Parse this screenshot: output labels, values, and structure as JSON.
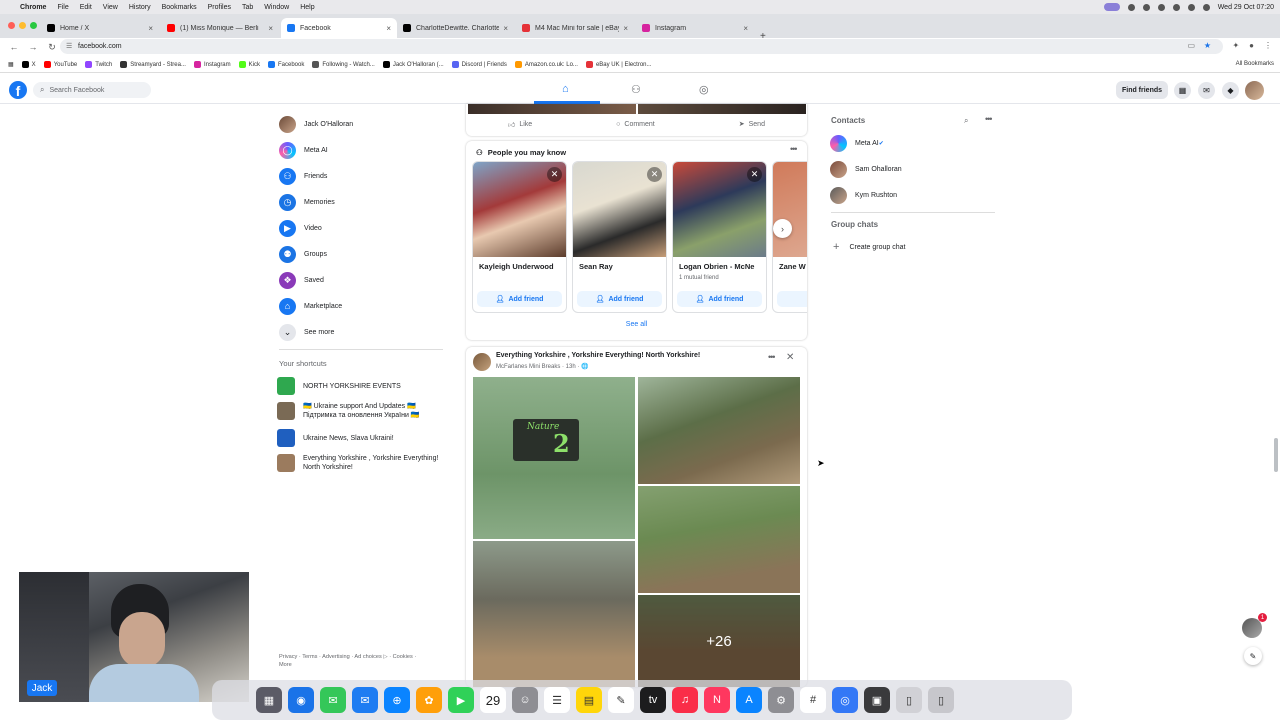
{
  "macos": {
    "menu": [
      "Chrome",
      "File",
      "Edit",
      "View",
      "History",
      "Bookmarks",
      "Profiles",
      "Tab",
      "Window",
      "Help"
    ],
    "clock": "Wed 29 Oct 07:20"
  },
  "browser": {
    "tabs": [
      {
        "title": "Home / X",
        "icon": "x-logo-icon",
        "color": "#000000"
      },
      {
        "title": "(1) Miss Monique — Berli",
        "icon": "youtube-icon",
        "color": "#ff0000"
      },
      {
        "title": "Facebook",
        "icon": "facebook-icon",
        "color": "#1877f2"
      },
      {
        "title": "CharlotteDewitte. Charlotte",
        "icon": "x-logo-icon",
        "color": "#000000"
      },
      {
        "title": "M4 Mac Mini for sale | eBay",
        "icon": "ebay-icon",
        "color": "#e53238"
      },
      {
        "title": "Instagram",
        "icon": "instagram-icon",
        "color": "#d6249f"
      }
    ],
    "url": "facebook.com",
    "bookmarks": [
      {
        "label": "X",
        "color": "#000000"
      },
      {
        "label": "YouTube",
        "color": "#ff0000"
      },
      {
        "label": "Twitch",
        "color": "#9146ff"
      },
      {
        "label": "Streamyard - Strea...",
        "color": "#333333"
      },
      {
        "label": "Instagram",
        "color": "#d6249f"
      },
      {
        "label": "Kick",
        "color": "#53fc18"
      },
      {
        "label": "Facebook",
        "color": "#1877f2"
      },
      {
        "label": "Following - Watch...",
        "color": "#555555"
      },
      {
        "label": "Jack O'Halloran (...",
        "color": "#000000"
      },
      {
        "label": "Discord | Friends",
        "color": "#5865f2"
      },
      {
        "label": "Amazon.co.uk: Lo...",
        "color": "#ff9900"
      },
      {
        "label": "eBay UK | Electron...",
        "color": "#e53238"
      }
    ],
    "all_bookmarks": "All Bookmarks"
  },
  "fb": {
    "search_placeholder": "Search Facebook",
    "find_friends": "Find friends",
    "leftnav": [
      {
        "label": "Jack O'Halloran",
        "icon": "profile-avatar",
        "color": "#8b6a55"
      },
      {
        "label": "Meta AI",
        "icon": "meta-ai-icon",
        "color": "#6a5cff"
      },
      {
        "label": "Friends",
        "icon": "friends-icon",
        "color": "#1877f2"
      },
      {
        "label": "Memories",
        "icon": "memories-icon",
        "color": "#1b74e4"
      },
      {
        "label": "Video",
        "icon": "video-icon",
        "color": "#1877f2"
      },
      {
        "label": "Groups",
        "icon": "groups-icon",
        "color": "#1b74e4"
      },
      {
        "label": "Saved",
        "icon": "saved-icon",
        "color": "#8a3ab9"
      },
      {
        "label": "Marketplace",
        "icon": "marketplace-icon",
        "color": "#1877f2"
      },
      {
        "label": "See more",
        "icon": "chevron-down-icon",
        "color": "#e4e6eb"
      }
    ],
    "shortcuts_title": "Your shortcuts",
    "shortcuts": [
      {
        "label": "NORTH YORKSHIRE EVENTS",
        "color": "#2fa84f"
      },
      {
        "label": "🇺🇦 Ukraine support And Updates 🇺🇦 Підтримка та оновлення України 🇺🇦",
        "color": "#7a6a55"
      },
      {
        "label": "Ukraine News, Slava Ukraini!",
        "color": "#1f5fbf"
      },
      {
        "label": "Everything Yorkshire , Yorkshire Everything! North Yorkshire!",
        "color": "#9b7b5e"
      }
    ],
    "footer": "Privacy · Terms · Advertising · Ad choices ▷ · Cookies · More",
    "actions": {
      "like": "Like",
      "comment": "Comment",
      "send": "Send"
    },
    "pymk": {
      "title": "People you may know",
      "people": [
        {
          "name": "Kayleigh Underwood",
          "mutual": "",
          "add": "Add friend"
        },
        {
          "name": "Sean Ray",
          "mutual": "",
          "add": "Add friend"
        },
        {
          "name": "Logan Obrien - McNe",
          "mutual": "1 mutual friend",
          "add": "Add friend"
        },
        {
          "name": "Zane W",
          "mutual": "",
          "add": ""
        }
      ],
      "see_all": "See all"
    },
    "post": {
      "group": "Everything Yorkshire , Yorkshire Everything! North Yorkshire!",
      "meta": "McFarlanes Mini Breaks · 13h · 🌐",
      "sign_text_1": "Nature",
      "sign_text_2": "2",
      "more_count": "+26"
    },
    "contacts_title": "Contacts",
    "contacts": [
      {
        "name": "Meta AI",
        "color": "#6a5cff"
      },
      {
        "name": "Sam Ohalloran",
        "color": "#7a4a3a"
      },
      {
        "name": "Kym Rushton",
        "color": "#5a5a5a"
      }
    ],
    "group_chats_title": "Group chats",
    "create_group": "Create group chat",
    "chat_badge": "1"
  },
  "webcam": {
    "name": "Jack"
  },
  "dock": [
    {
      "icon": "launchpad-icon",
      "color": "#5b5b66"
    },
    {
      "icon": "chrome-icon",
      "color": "#1a73e8"
    },
    {
      "icon": "messages-icon",
      "color": "#34c759"
    },
    {
      "icon": "mail-icon",
      "color": "#1e7cf2"
    },
    {
      "icon": "safari-icon",
      "color": "#0a84ff"
    },
    {
      "icon": "photos-icon",
      "color": "#ff9f0a"
    },
    {
      "icon": "facetime-icon",
      "color": "#30d158"
    },
    {
      "icon": "calendar-icon",
      "color": "#ffffff",
      "text": "29"
    },
    {
      "icon": "contacts-icon",
      "color": "#8e8e93"
    },
    {
      "icon": "reminders-icon",
      "color": "#ffffff"
    },
    {
      "icon": "notes-icon",
      "color": "#ffd60a"
    },
    {
      "icon": "freeform-icon",
      "color": "#ffffff"
    },
    {
      "icon": "tv-icon",
      "color": "#1c1c1e"
    },
    {
      "icon": "music-icon",
      "color": "#fa2d48"
    },
    {
      "icon": "news-icon",
      "color": "#ff375f"
    },
    {
      "icon": "app-store-icon",
      "color": "#0a84ff"
    },
    {
      "icon": "settings-icon",
      "color": "#8e8e93"
    },
    {
      "icon": "slack-icon",
      "color": "#ffffff"
    },
    {
      "icon": "vpn-icon",
      "color": "#3478f6"
    },
    {
      "icon": "stream-deck-icon",
      "color": "#3a3a3c"
    },
    {
      "icon": "downloads-icon",
      "color": "#d1d1d6"
    },
    {
      "icon": "trash-icon",
      "color": "#c7c7cc"
    }
  ]
}
